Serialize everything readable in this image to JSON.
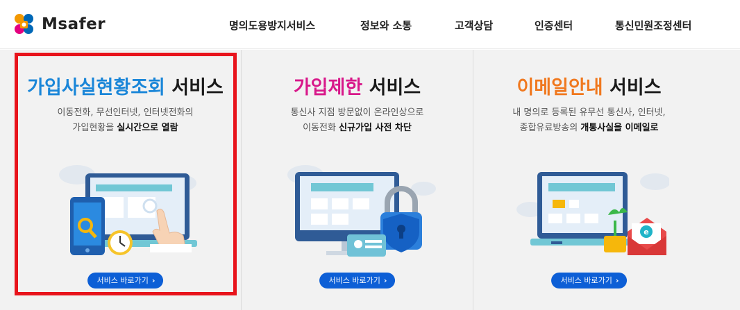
{
  "brand": {
    "name": "Msafer",
    "colors": [
      "#f39800",
      "#0068b7",
      "#e4007f",
      "#22ac38"
    ]
  },
  "nav": {
    "items": [
      {
        "label": "명의도용방지서비스"
      },
      {
        "label": "정보와 소통"
      },
      {
        "label": "고객상담"
      },
      {
        "label": "인증센터"
      },
      {
        "label": "통신민원조정센터"
      }
    ]
  },
  "services": [
    {
      "title_highlight": "가입사실현황조회",
      "title_rest": " 서비스",
      "accent": "#1a86d8",
      "desc_line1": "이동전화, 무선인터넷, 인터넷전화의",
      "desc_line2_pre": "가입현황을 ",
      "desc_line2_bold": "실시간으로 열람",
      "button": "서비스 바로가기",
      "chevron": "›",
      "icon": "phone-magnifier-clock-icon"
    },
    {
      "title_highlight": "가입제한",
      "title_rest": " 서비스",
      "accent": "#d8188a",
      "desc_line1": "통신사 지점 방문없이 온라인상으로",
      "desc_line2_pre": "이동전화 ",
      "desc_line2_bold": "신규가입 사전 차단",
      "button": "서비스 바로가기",
      "chevron": "›",
      "icon": "monitor-lock-shield-icon"
    },
    {
      "title_highlight": "이메일안내",
      "title_rest": " 서비스",
      "accent": "#f0781e",
      "desc_line1": "내 명의로 등록된 유무선 통신사, 인터넷,",
      "desc_line2_pre": "종합유료방송의 ",
      "desc_line2_bold": "개통사실을 이메일로",
      "button": "서비스 바로가기",
      "chevron": "›",
      "icon": "laptop-envelope-plant-icon"
    }
  ]
}
